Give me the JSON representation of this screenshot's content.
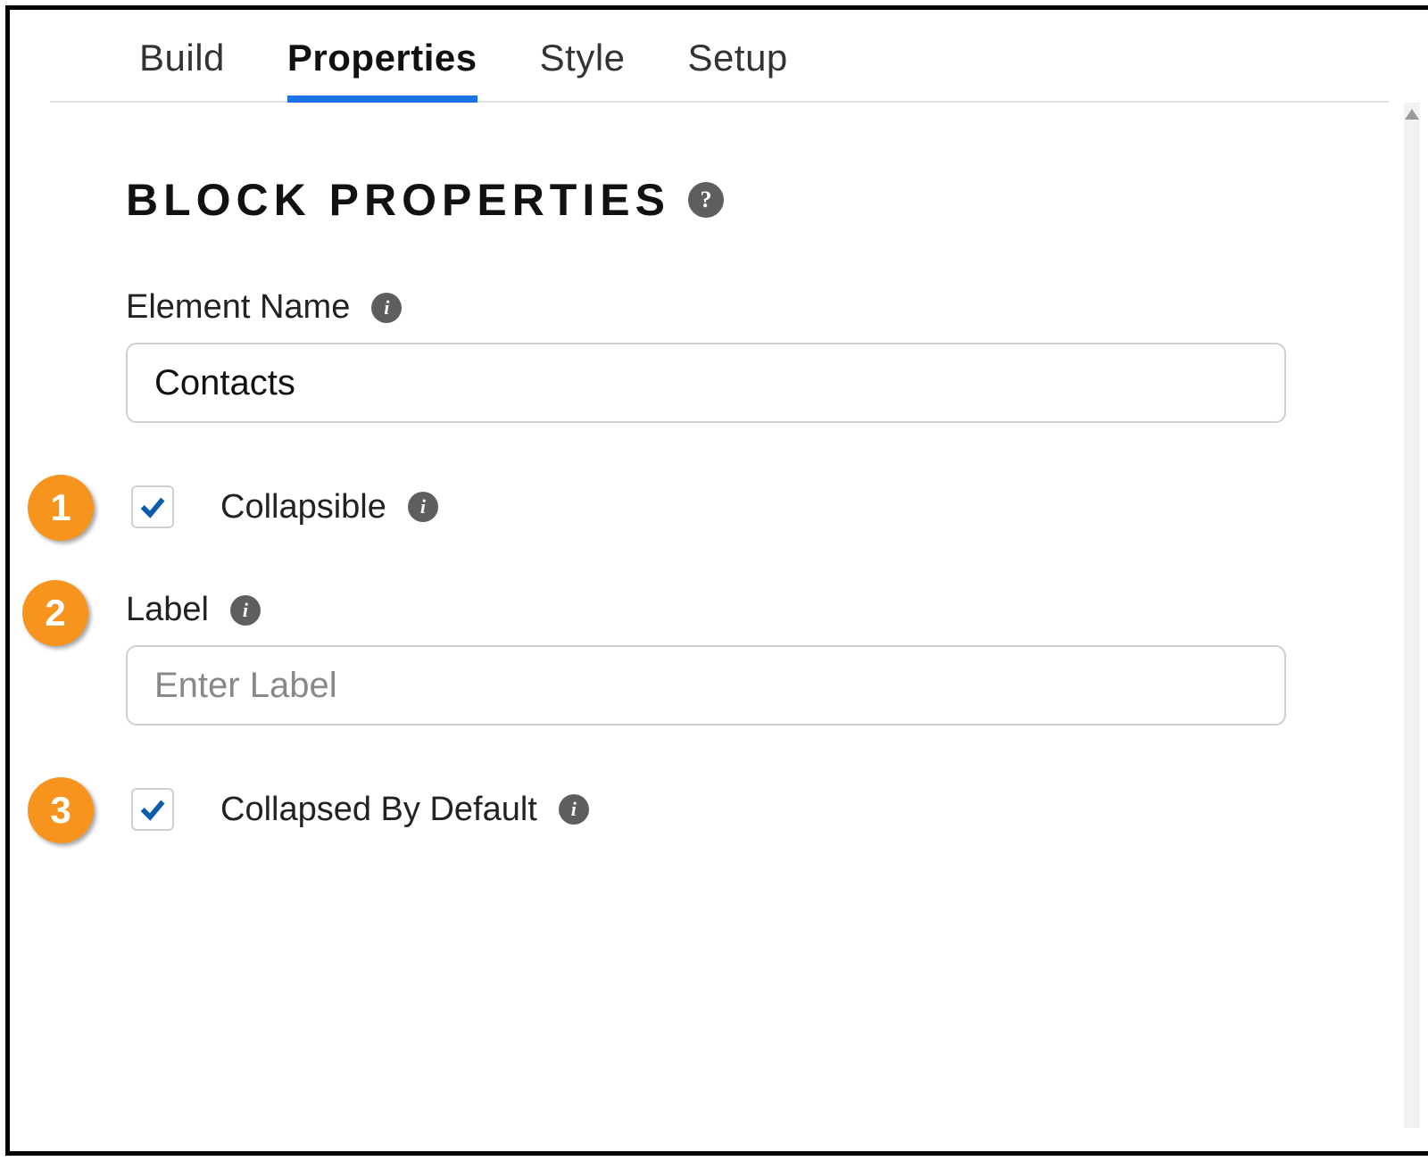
{
  "tabs": {
    "build": "Build",
    "properties": "Properties",
    "style": "Style",
    "setup": "Setup"
  },
  "section": {
    "heading": "BLOCK PROPERTIES"
  },
  "fields": {
    "elementName": {
      "label": "Element Name",
      "value": "Contacts"
    },
    "collapsible": {
      "label": "Collapsible",
      "checked": true
    },
    "label": {
      "label": "Label",
      "placeholder": "Enter Label",
      "value": ""
    },
    "collapsedByDefault": {
      "label": "Collapsed By Default",
      "checked": true
    }
  },
  "callouts": {
    "one": "1",
    "two": "2",
    "three": "3"
  },
  "icons": {
    "help": "?",
    "info": "i"
  }
}
